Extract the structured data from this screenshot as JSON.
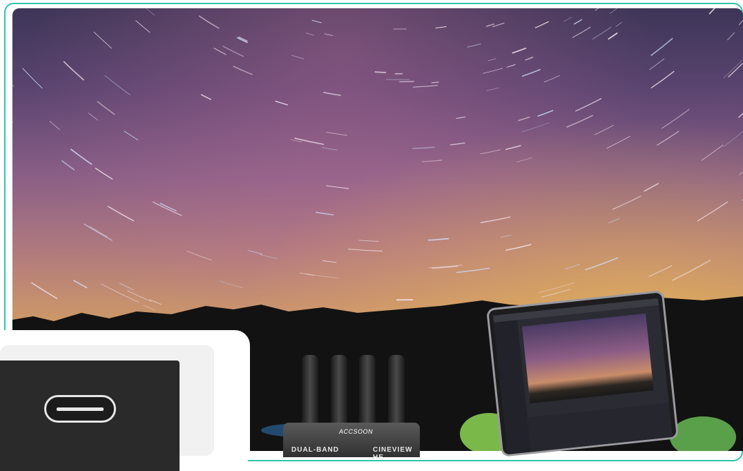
{
  "scene": {
    "description_icon": "night-sky-star-trails-photo"
  },
  "usb_card": {
    "icon": "usb-c-port-icon"
  },
  "transmitter": {
    "logo": "ACCSOON",
    "left_label": "DUAL-BAND",
    "right_label": "CINEVIEW HE"
  },
  "laptop": {
    "icon": "laptop-editing-software"
  },
  "colors": {
    "frame_border": "#2ec4a6",
    "card_background": "#ffffff"
  }
}
